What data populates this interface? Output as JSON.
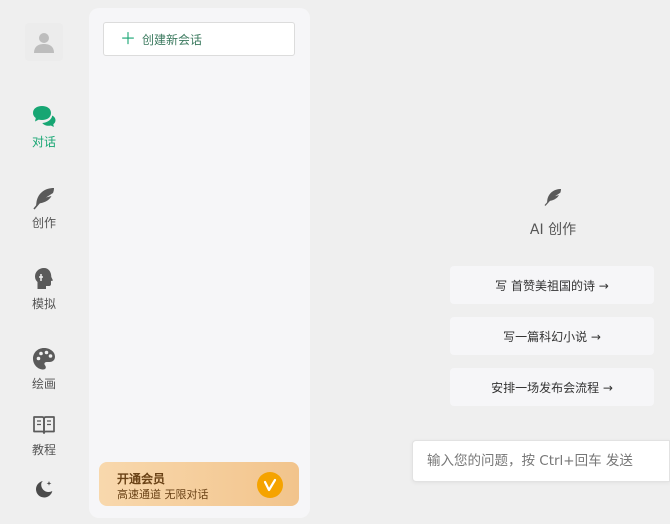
{
  "sidebar": {
    "items": [
      {
        "label": "对话",
        "icon": "chat-bubbles-icon",
        "active": true
      },
      {
        "label": "创作",
        "icon": "feather-icon",
        "active": false
      },
      {
        "label": "模拟",
        "icon": "head-profile-icon",
        "active": false
      },
      {
        "label": "绘画",
        "icon": "palette-icon",
        "active": false
      },
      {
        "label": "教程",
        "icon": "open-book-icon",
        "active": false
      }
    ],
    "theme_icon": "moon-icon"
  },
  "conversations": {
    "new_chat_label": "创建新会话",
    "items": []
  },
  "membership": {
    "title": "开通会员",
    "subtitle": "高速通道 无限对话",
    "badge_icon": "vip-badge-icon"
  },
  "main": {
    "icon": "feather-icon",
    "title": "AI 创作",
    "prompts": [
      "写  首赞美祖国的诗 →",
      "写一篇科幻小说 →",
      "安排一场发布会流程 →"
    ],
    "input_placeholder": "输入您的问题，按 Ctrl+回车 发送"
  },
  "colors": {
    "accent": "#17a673",
    "icon_gray": "#5a5a5a",
    "background": "#efefef",
    "panel": "#f6f6f8",
    "vip_gradient_start": "#f8d8ad",
    "vip_gradient_end": "#f2c48c",
    "vip_text": "#6a4216"
  }
}
